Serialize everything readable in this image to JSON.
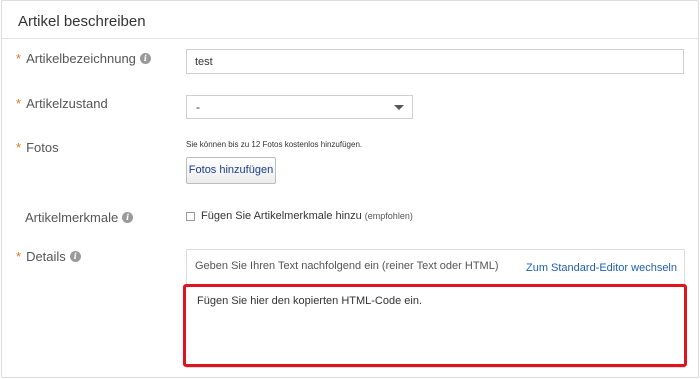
{
  "section": {
    "title": "Artikel beschreiben"
  },
  "required_marker": "*",
  "info_glyph": "i",
  "fields": {
    "title": {
      "label": "Artikelbezeichnung",
      "value": "test"
    },
    "condition": {
      "label": "Artikelzustand",
      "selected": "-"
    },
    "photos": {
      "label": "Fotos",
      "hint": "Sie können bis zu 12 Fotos kostenlos hinzufügen.",
      "button_label": "Fotos hinzufügen"
    },
    "item_specifics": {
      "label": "Artikelmerkmale",
      "checkbox_label": "Fügen Sie Artikelmerkmale hinzu",
      "checkbox_hint": "(empfohlen)",
      "checked": false
    },
    "details": {
      "label": "Details",
      "editor_hint": "Geben Sie Ihren Text nachfolgend ein (reiner Text oder HTML)",
      "switch_link": "Zum Standard-Editor wechseln",
      "content": "Fügen Sie hier den kopierten HTML-Code ein."
    }
  },
  "colors": {
    "required": "#e3751c",
    "link": "#1f5fb5",
    "highlight_border": "#e0141e",
    "button_text": "#1a3e8c"
  },
  "icons": {
    "info": "info-icon",
    "dropdown": "chevron-down-icon"
  }
}
